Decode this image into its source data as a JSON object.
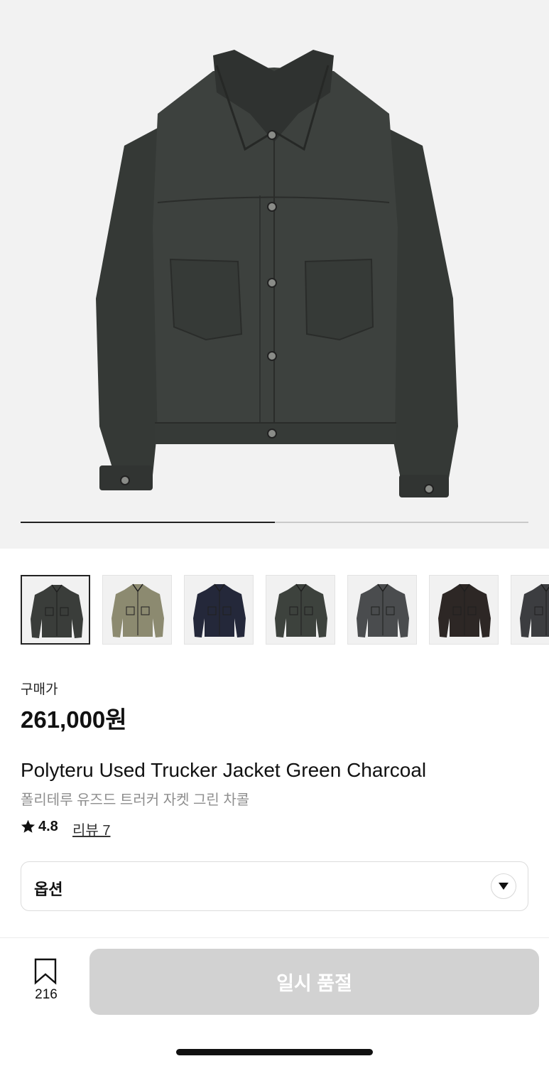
{
  "gallery": {
    "image_alt": "jacket-photo",
    "current_index": 1,
    "total_images": 7,
    "progress_fraction": 0.5,
    "thumbnails": [
      {
        "name": "thumb-charcoal",
        "color": "#3a3d3a",
        "selected": true
      },
      {
        "name": "thumb-camo",
        "color": "#8c8a70",
        "selected": false
      },
      {
        "name": "thumb-navy",
        "color": "#24283a",
        "selected": false
      },
      {
        "name": "thumb-green",
        "color": "#3d423d",
        "selected": false
      },
      {
        "name": "thumb-grey",
        "color": "#4a4c4e",
        "selected": false
      },
      {
        "name": "thumb-brown",
        "color": "#2d2725",
        "selected": false
      },
      {
        "name": "thumb-black",
        "color": "#3c3d40",
        "selected": false
      }
    ]
  },
  "product": {
    "price_label": "구매가",
    "price": "261,000원",
    "title_en": "Polyteru Used Trucker Jacket Green Charcoal",
    "title_ko": "폴리테루 유즈드 트러커 자켓 그린 차콜",
    "rating": "4.8",
    "review_label": "리뷰 7"
  },
  "options": {
    "label": "옵션"
  },
  "footer": {
    "bookmark_count": "216",
    "button_label": "일시 품절"
  },
  "colors": {
    "accent": "#222222",
    "button_disabled": "#d2d2d2"
  }
}
